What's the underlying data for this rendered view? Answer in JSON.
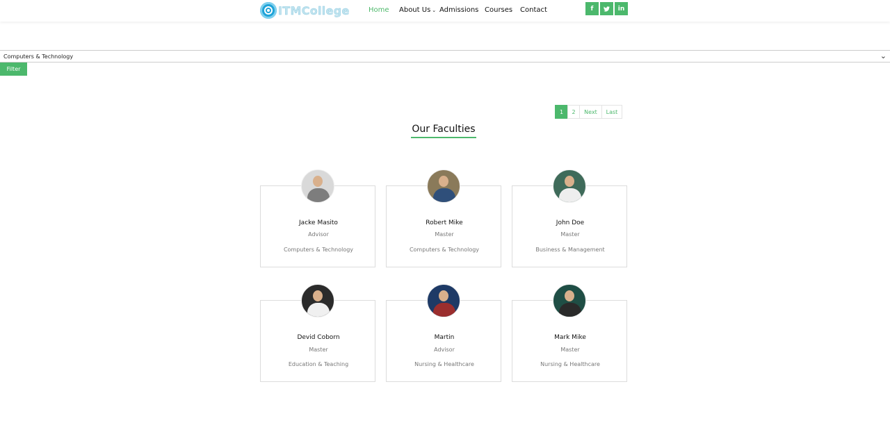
{
  "header": {
    "logo_text": "ITMCollege",
    "nav": [
      {
        "label": "Home",
        "active": true
      },
      {
        "label": "About Us",
        "has_dropdown": true
      },
      {
        "label": "Admissions"
      },
      {
        "label": "Courses"
      },
      {
        "label": "Contact"
      }
    ],
    "social": [
      {
        "icon": "facebook-icon",
        "glyph": "f"
      },
      {
        "icon": "twitter-icon",
        "glyph": "t"
      },
      {
        "icon": "linkedin-icon",
        "glyph": "in"
      }
    ]
  },
  "filter": {
    "selected": "Computers & Technology",
    "button_label": "Filter"
  },
  "pagination": {
    "pages": [
      "1",
      "2"
    ],
    "current": "1",
    "next_label": "Next",
    "last_label": "Last"
  },
  "section": {
    "title": "Our Faculties"
  },
  "faculties": [
    {
      "name": "Jacke Masito",
      "role": "Advisor",
      "department": "Computers & Technology",
      "avatar_bg": "#d9d9d9",
      "avatar_body": "#7d7d7d"
    },
    {
      "name": "Robert Mike",
      "role": "Master",
      "department": "Computers & Technology",
      "avatar_bg": "#8a7a5a",
      "avatar_body": "#2f4f7a"
    },
    {
      "name": "John Doe",
      "role": "Master",
      "department": "Business & Management",
      "avatar_bg": "#3f6b5a",
      "avatar_body": "#eeeeee"
    },
    {
      "name": "Devid Coborn",
      "role": "Master",
      "department": "Education & Teaching",
      "avatar_bg": "#2b2b2b",
      "avatar_body": "#f0f0f0"
    },
    {
      "name": "Martin",
      "role": "Advisor",
      "department": "Nursing & Healthcare",
      "avatar_bg": "#1e3a66",
      "avatar_body": "#9b2e2e"
    },
    {
      "name": "Mark Mike",
      "role": "Master",
      "department": "Nursing & Healthcare",
      "avatar_bg": "#1f4e45",
      "avatar_body": "#2a2a2a"
    }
  ],
  "colors": {
    "accent": "#4cb86c",
    "logo": "#1fa3d8"
  }
}
